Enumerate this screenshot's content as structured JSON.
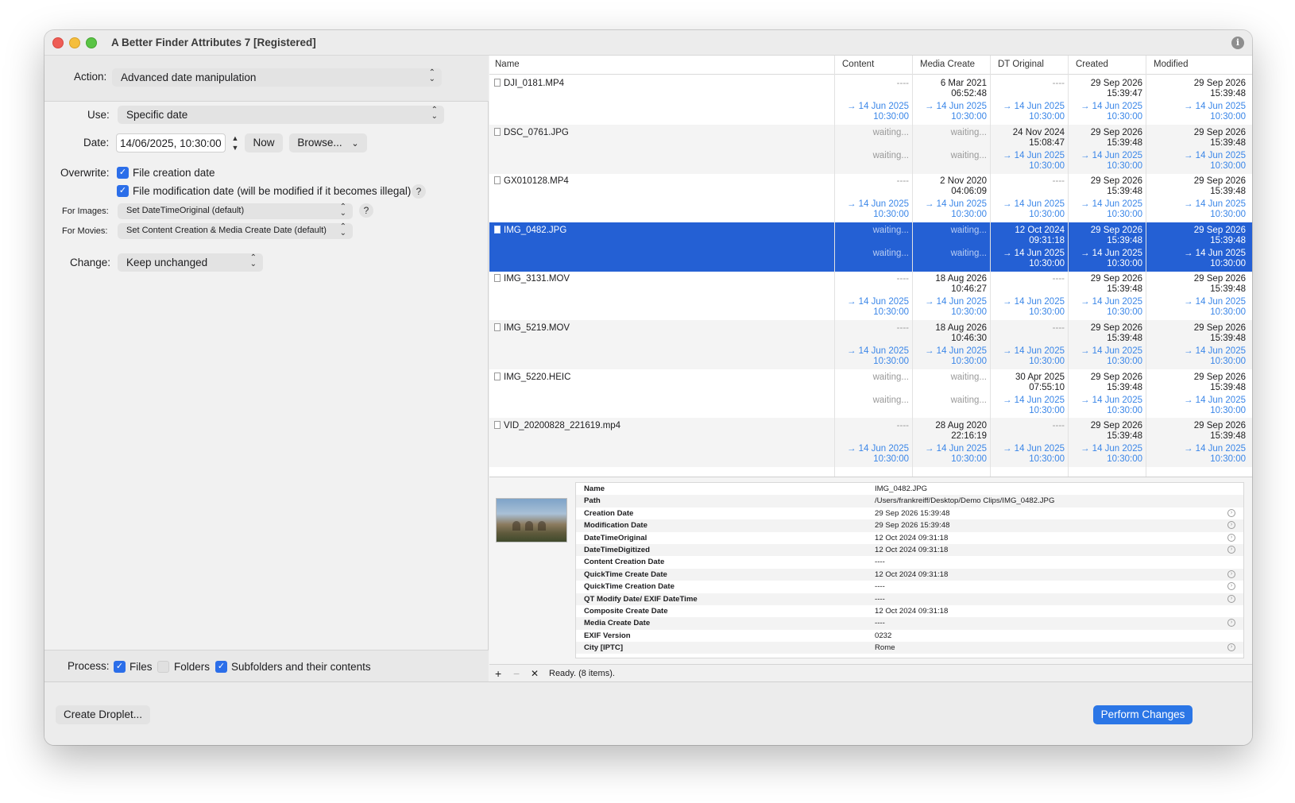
{
  "window": {
    "title": "A Better Finder Attributes 7 [Registered]",
    "info_icon": "i"
  },
  "left": {
    "action_label": "Action:",
    "action_value": "Advanced date manipulation",
    "use_label": "Use:",
    "use_value": "Specific date",
    "date_label": "Date:",
    "date_value": "14/06/2025, 10:30:00",
    "now_button": "Now",
    "browse_button": "Browse...",
    "overwrite_label": "Overwrite:",
    "overwrite_creation": "File creation date",
    "overwrite_modification": "File modification date (will be modified if it becomes illegal)",
    "help_mark": "?",
    "for_images_label": "For Images:",
    "for_images_value": "Set DateTimeOriginal (default)",
    "for_movies_label": "For Movies:",
    "for_movies_value": "Set Content Creation & Media Create Date (default)",
    "change_label": "Change:",
    "change_value": "Keep unchanged",
    "process_label": "Process:",
    "process_files": "Files",
    "process_folders": "Folders",
    "process_subfolders": "Subfolders and their contents",
    "files_checked": true,
    "folders_checked": false,
    "subfolders_checked": true
  },
  "footer": {
    "create_droplet": "Create Droplet...",
    "perform_changes": "Perform Changes"
  },
  "table": {
    "columns": [
      "Name",
      "Content",
      "Media Create",
      "DT Original",
      "Created",
      "Modified"
    ],
    "rows": [
      {
        "name": "DJI_0181.MP4",
        "cells": [
          {
            "old": "----",
            "new": "→ 14 Jun 2025\n10:30:00"
          },
          {
            "old": "6 Mar 2021\n06:52:48",
            "new": "→ 14 Jun 2025\n10:30:00"
          },
          {
            "old": "----",
            "new": "→ 14 Jun 2025\n10:30:00"
          },
          {
            "old": "29 Sep 2026\n15:39:47",
            "new": "→ 14 Jun 2025\n10:30:00"
          },
          {
            "old": "29 Sep 2026\n15:39:48",
            "new": "→ 14 Jun 2025\n10:30:00"
          }
        ]
      },
      {
        "name": "DSC_0761.JPG",
        "cells": [
          {
            "old": "waiting...",
            "new": "waiting..."
          },
          {
            "old": "waiting...",
            "new": "waiting..."
          },
          {
            "old": "24 Nov 2024\n15:08:47",
            "new": "→ 14 Jun 2025\n10:30:00"
          },
          {
            "old": "29 Sep 2026\n15:39:48",
            "new": "→ 14 Jun 2025\n10:30:00"
          },
          {
            "old": "29 Sep 2026\n15:39:48",
            "new": "→ 14 Jun 2025\n10:30:00"
          }
        ]
      },
      {
        "name": "GX010128.MP4",
        "cells": [
          {
            "old": "----",
            "new": "→ 14 Jun 2025\n10:30:00"
          },
          {
            "old": "2 Nov 2020\n04:06:09",
            "new": "→ 14 Jun 2025\n10:30:00"
          },
          {
            "old": "----",
            "new": "→ 14 Jun 2025\n10:30:00"
          },
          {
            "old": "29 Sep 2026\n15:39:48",
            "new": "→ 14 Jun 2025\n10:30:00"
          },
          {
            "old": "29 Sep 2026\n15:39:48",
            "new": "→ 14 Jun 2025\n10:30:00"
          }
        ]
      },
      {
        "name": "IMG_0482.JPG",
        "selected": true,
        "cells": [
          {
            "old": "waiting...",
            "new": "waiting..."
          },
          {
            "old": "waiting...",
            "new": "waiting..."
          },
          {
            "old": "12 Oct 2024\n09:31:18",
            "new": "→ 14 Jun 2025\n10:30:00"
          },
          {
            "old": "29 Sep 2026\n15:39:48",
            "new": "→ 14 Jun 2025\n10:30:00"
          },
          {
            "old": "29 Sep 2026\n15:39:48",
            "new": "→ 14 Jun 2025\n10:30:00"
          }
        ]
      },
      {
        "name": "IMG_3131.MOV",
        "cells": [
          {
            "old": "----",
            "new": "→ 14 Jun 2025\n10:30:00"
          },
          {
            "old": "18 Aug 2026\n10:46:27",
            "new": "→ 14 Jun 2025\n10:30:00"
          },
          {
            "old": "----",
            "new": "→ 14 Jun 2025\n10:30:00"
          },
          {
            "old": "29 Sep 2026\n15:39:48",
            "new": "→ 14 Jun 2025\n10:30:00"
          },
          {
            "old": "29 Sep 2026\n15:39:48",
            "new": "→ 14 Jun 2025\n10:30:00"
          }
        ]
      },
      {
        "name": "IMG_5219.MOV",
        "cells": [
          {
            "old": "----",
            "new": "→ 14 Jun 2025\n10:30:00"
          },
          {
            "old": "18 Aug 2026\n10:46:30",
            "new": "→ 14 Jun 2025\n10:30:00"
          },
          {
            "old": "----",
            "new": "→ 14 Jun 2025\n10:30:00"
          },
          {
            "old": "29 Sep 2026\n15:39:48",
            "new": "→ 14 Jun 2025\n10:30:00"
          },
          {
            "old": "29 Sep 2026\n15:39:48",
            "new": "→ 14 Jun 2025\n10:30:00"
          }
        ]
      },
      {
        "name": "IMG_5220.HEIC",
        "cells": [
          {
            "old": "waiting...",
            "new": "waiting..."
          },
          {
            "old": "waiting...",
            "new": "waiting..."
          },
          {
            "old": "30 Apr 2025\n07:55:10",
            "new": "→ 14 Jun 2025\n10:30:00"
          },
          {
            "old": "29 Sep 2026\n15:39:48",
            "new": "→ 14 Jun 2025\n10:30:00"
          },
          {
            "old": "29 Sep 2026\n15:39:48",
            "new": "→ 14 Jun 2025\n10:30:00"
          }
        ]
      },
      {
        "name": "VID_20200828_221619.mp4",
        "cells": [
          {
            "old": "----",
            "new": "→ 14 Jun 2025\n10:30:00"
          },
          {
            "old": "28 Aug 2020\n22:16:19",
            "new": "→ 14 Jun 2025\n10:30:00"
          },
          {
            "old": "----",
            "new": "→ 14 Jun 2025\n10:30:00"
          },
          {
            "old": "29 Sep 2026\n15:39:48",
            "new": "→ 14 Jun 2025\n10:30:00"
          },
          {
            "old": "29 Sep 2026\n15:39:48",
            "new": "→ 14 Jun 2025\n10:30:00"
          }
        ]
      }
    ]
  },
  "details": {
    "rows": [
      {
        "key": "Name",
        "value": "IMG_0482.JPG",
        "icon": false
      },
      {
        "key": "Path",
        "value": "/Users/frankreiff/Desktop/Demo Clips/IMG_0482.JPG",
        "icon": false
      },
      {
        "key": "Creation Date",
        "value": "29 Sep 2026 15:39:48",
        "icon": true
      },
      {
        "key": "Modification Date",
        "value": "29 Sep 2026 15:39:48",
        "icon": true
      },
      {
        "key": "DateTimeOriginal",
        "value": "12 Oct 2024 09:31:18",
        "icon": true
      },
      {
        "key": "DateTimeDigitized",
        "value": "12 Oct 2024 09:31:18",
        "icon": true
      },
      {
        "key": "Content Creation Date",
        "value": "----",
        "icon": false
      },
      {
        "key": "QuickTime Create Date",
        "value": "12 Oct 2024 09:31:18",
        "icon": true
      },
      {
        "key": "QuickTime Creation Date",
        "value": "----",
        "icon": true
      },
      {
        "key": "QT Modify Date/ EXIF DateTime",
        "value": "----",
        "icon": true
      },
      {
        "key": "Composite Create Date",
        "value": "12 Oct 2024 09:31:18",
        "icon": false
      },
      {
        "key": "Media Create Date",
        "value": "----",
        "icon": true
      },
      {
        "key": "EXIF Version",
        "value": "0232",
        "icon": false
      },
      {
        "key": "City [IPTC]",
        "value": "Rome",
        "icon": true
      }
    ]
  },
  "statusbar": {
    "add": "+",
    "remove": "−",
    "clear": "✕",
    "status": "Ready. (8 items)."
  },
  "colors": {
    "accent": "#2b76e6",
    "selection": "#2460d4",
    "new_value": "#3a86e8"
  }
}
